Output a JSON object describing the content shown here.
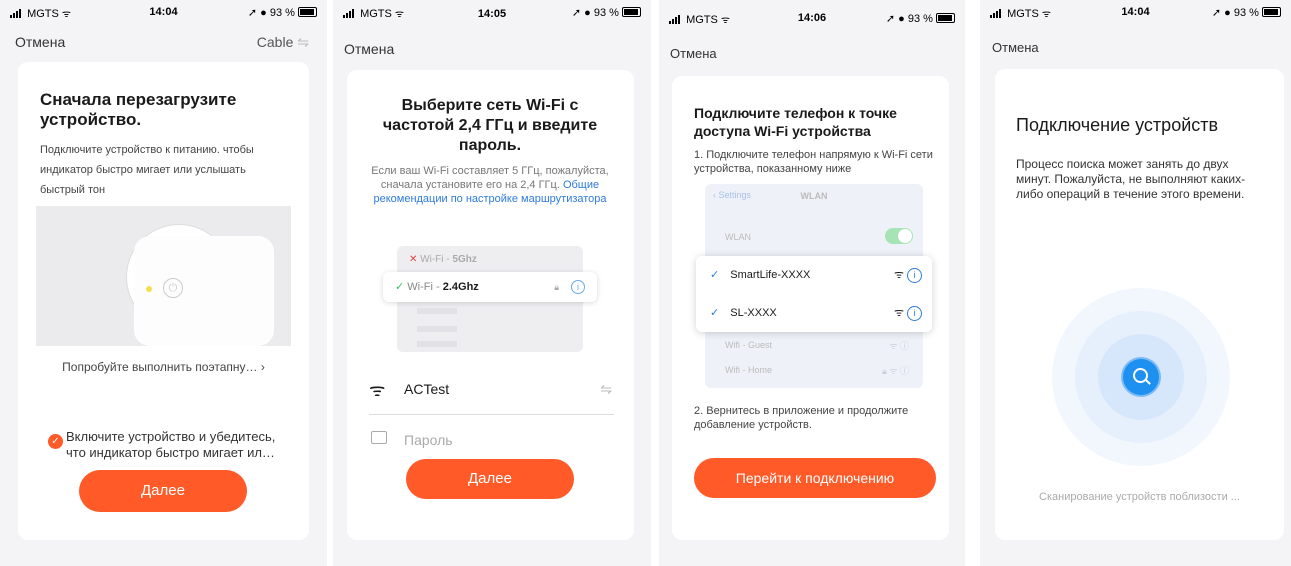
{
  "screens": [
    {
      "status": {
        "carrier": "MGTS",
        "time": "14:04",
        "battery": "93 %"
      },
      "nav": {
        "cancel": "Отмена",
        "right": "Cable"
      },
      "title": "Сначала перезагрузите устройство.",
      "body": "Подключите устройство к питанию. чтобы индикатор быстро мигает или услышать быстрый тон",
      "step_link": "Попробуйте выполнить поэтапну…",
      "check_text_1": "Включите устройство и убедитесь,",
      "check_text_2": "что индикатор быстро мигает ил…",
      "next": "Далее"
    },
    {
      "status": {
        "carrier": "MGTS",
        "time": "14:05",
        "battery": "93 %"
      },
      "nav": {
        "cancel": "Отмена"
      },
      "title": "Выберите сеть Wi-Fi с частотой 2,4 ГГц и введите пароль.",
      "body": "Если ваш Wi-Fi составляет 5 ГГц, пожалуйста, сначала установите его на 2,4 ГГц.",
      "link": "Общие рекомендации по настройке маршрутизатора",
      "wifi5": {
        "prefix": "Wi-Fi - ",
        "band": "5Ghz"
      },
      "wifi24": {
        "prefix": "Wi-Fi - ",
        "band": "2.4Ghz"
      },
      "ssid": "ACTest",
      "password_placeholder": "Пароль",
      "next": "Далее"
    },
    {
      "status": {
        "carrier": "MGTS",
        "time": "14:06",
        "battery": "93 %"
      },
      "nav": {
        "cancel": "Отмена"
      },
      "title": "Подключите телефон к точке доступа Wi-Fi устройства",
      "step1": "1. Подключите телефон напрямую к Wi-Fi сети устройства, показанному ниже",
      "settings_back": "Settings",
      "settings_title": "WLAN",
      "wlan_label": "WLAN",
      "networks": [
        "SmartLife-XXXX",
        "SL-XXXX"
      ],
      "other_networks": [
        "Wifi - Guest",
        "Wifi - Home"
      ],
      "step2": "2. Вернитесь в приложение и продолжите добавление устройств.",
      "go": "Перейти к подключению"
    },
    {
      "status": {
        "carrier": "MGTS",
        "time": "14:04",
        "battery": "93 %"
      },
      "nav": {
        "cancel": "Отмена"
      },
      "title": "Подключение устройств",
      "body": "Процесс поиска может занять до двух минут. Пожалуйста, не выполняют каких-либо операций в течение этого времени.",
      "scanning": "Сканирование устройств поблизости ..."
    }
  ],
  "colors": {
    "accent": "#ff5a28",
    "link": "#2f7bdd",
    "toggle": "#4cd964",
    "check": "#2f7bdd"
  }
}
